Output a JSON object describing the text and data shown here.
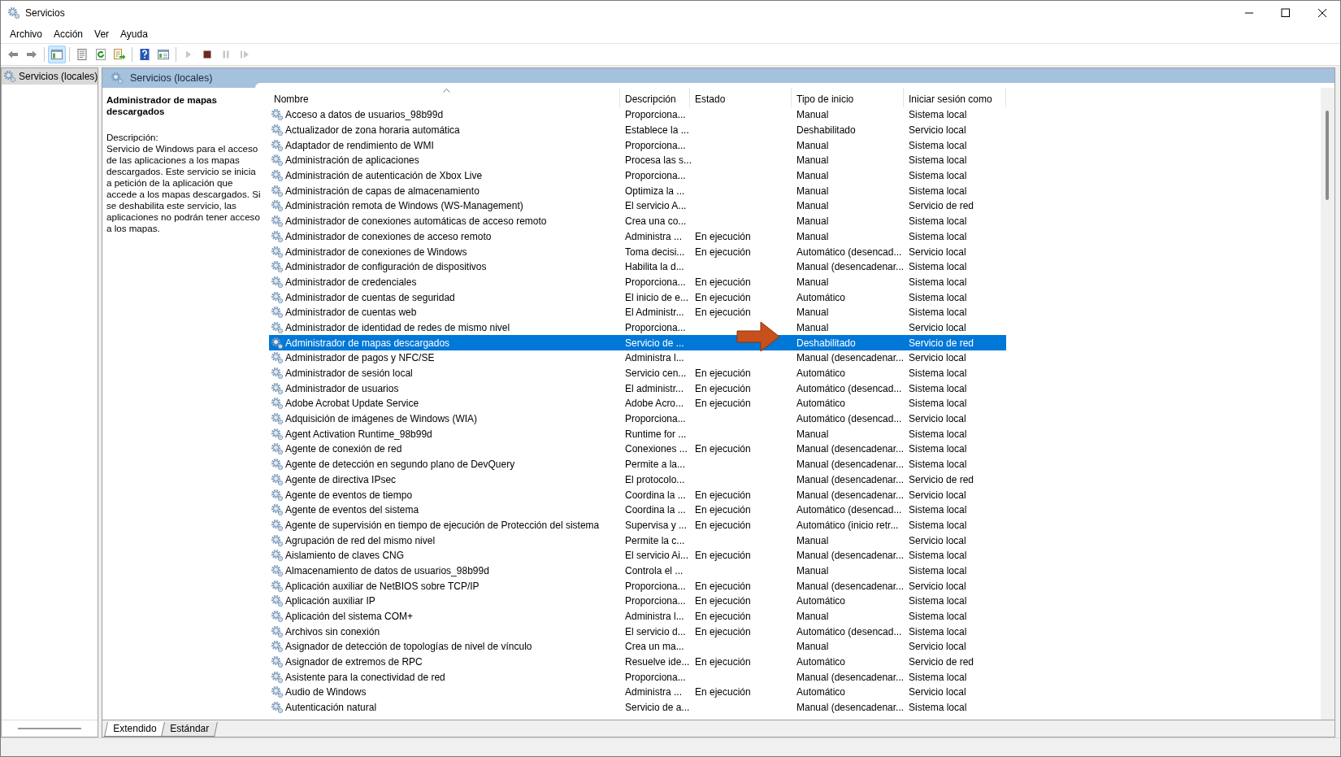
{
  "window": {
    "title": "Servicios"
  },
  "menu": [
    "Archivo",
    "Acción",
    "Ver",
    "Ayuda"
  ],
  "toolbar": [
    {
      "kind": "back",
      "disabled": false,
      "pressed": false
    },
    {
      "kind": "forward",
      "disabled": false,
      "pressed": false
    },
    {
      "kind": "sep"
    },
    {
      "kind": "tree",
      "disabled": false,
      "pressed": true
    },
    {
      "kind": "sep"
    },
    {
      "kind": "properties",
      "disabled": false,
      "pressed": false
    },
    {
      "kind": "refresh",
      "disabled": false,
      "pressed": false
    },
    {
      "kind": "export",
      "disabled": false,
      "pressed": false
    },
    {
      "kind": "sep"
    },
    {
      "kind": "help",
      "disabled": false,
      "pressed": false
    },
    {
      "kind": "pane",
      "disabled": false,
      "pressed": false
    },
    {
      "kind": "sep"
    },
    {
      "kind": "start",
      "disabled": true,
      "pressed": false
    },
    {
      "kind": "stop",
      "disabled": false,
      "pressed": false
    },
    {
      "kind": "pause",
      "disabled": true,
      "pressed": false
    },
    {
      "kind": "restart",
      "disabled": true,
      "pressed": false
    }
  ],
  "tree": {
    "items": [
      {
        "label": "Servicios (locales)",
        "selected": true
      }
    ]
  },
  "pane_header": "Servicios (locales)",
  "details": {
    "title": "Administrador de mapas descargados",
    "description_label": "Descripción:",
    "description": "Servicio de Windows para el acceso de las aplicaciones a los mapas descargados. Este servicio se inicia a petición de la aplicación que accede a los mapas descargados. Si se deshabilita este servicio, las aplicaciones no podrán tener acceso a los mapas."
  },
  "table": {
    "columns": [
      {
        "label": "Nombre",
        "sorted": true
      },
      {
        "label": "Descripción",
        "sorted": false
      },
      {
        "label": "Estado",
        "sorted": false
      },
      {
        "label": "Tipo de inicio",
        "sorted": false
      },
      {
        "label": "Iniciar sesión como",
        "sorted": false
      }
    ],
    "rows": [
      {
        "name": "Acceso a datos de usuarios_98b99d",
        "description": "Proporciona...",
        "status": "",
        "startup": "Manual",
        "logon": "Sistema local",
        "selected": false
      },
      {
        "name": "Actualizador de zona horaria automática",
        "description": "Establece la ...",
        "status": "",
        "startup": "Deshabilitado",
        "logon": "Servicio local",
        "selected": false
      },
      {
        "name": "Adaptador de rendimiento de WMI",
        "description": "Proporciona...",
        "status": "",
        "startup": "Manual",
        "logon": "Sistema local",
        "selected": false
      },
      {
        "name": "Administración de aplicaciones",
        "description": "Procesa las s...",
        "status": "",
        "startup": "Manual",
        "logon": "Sistema local",
        "selected": false
      },
      {
        "name": "Administración de autenticación de Xbox Live",
        "description": "Proporciona...",
        "status": "",
        "startup": "Manual",
        "logon": "Sistema local",
        "selected": false
      },
      {
        "name": "Administración de capas de almacenamiento",
        "description": "Optimiza la ...",
        "status": "",
        "startup": "Manual",
        "logon": "Sistema local",
        "selected": false
      },
      {
        "name": "Administración remota de Windows (WS-Management)",
        "description": "El servicio A...",
        "status": "",
        "startup": "Manual",
        "logon": "Servicio de red",
        "selected": false
      },
      {
        "name": "Administrador de conexiones automáticas de acceso remoto",
        "description": "Crea una co...",
        "status": "",
        "startup": "Manual",
        "logon": "Sistema local",
        "selected": false
      },
      {
        "name": "Administrador de conexiones de acceso remoto",
        "description": "Administra ...",
        "status": "En ejecución",
        "startup": "Manual",
        "logon": "Sistema local",
        "selected": false
      },
      {
        "name": "Administrador de conexiones de Windows",
        "description": "Toma decisi...",
        "status": "En ejecución",
        "startup": "Automático (desencad...",
        "logon": "Servicio local",
        "selected": false
      },
      {
        "name": "Administrador de configuración de dispositivos",
        "description": "Habilita la d...",
        "status": "",
        "startup": "Manual (desencadenar...",
        "logon": "Sistema local",
        "selected": false
      },
      {
        "name": "Administrador de credenciales",
        "description": "Proporciona...",
        "status": "En ejecución",
        "startup": "Manual",
        "logon": "Sistema local",
        "selected": false
      },
      {
        "name": "Administrador de cuentas de seguridad",
        "description": "El inicio de e...",
        "status": "En ejecución",
        "startup": "Automático",
        "logon": "Sistema local",
        "selected": false
      },
      {
        "name": "Administrador de cuentas web",
        "description": "El Administr...",
        "status": "En ejecución",
        "startup": "Manual",
        "logon": "Sistema local",
        "selected": false
      },
      {
        "name": "Administrador de identidad de redes de mismo nivel",
        "description": "Proporciona...",
        "status": "",
        "startup": "Manual",
        "logon": "Servicio local",
        "selected": false
      },
      {
        "name": "Administrador de mapas descargados",
        "description": "Servicio de ...",
        "status": "",
        "startup": "Deshabilitado",
        "logon": "Servicio de red",
        "selected": true
      },
      {
        "name": "Administrador de pagos y NFC/SE",
        "description": "Administra l...",
        "status": "",
        "startup": "Manual (desencadenar...",
        "logon": "Servicio local",
        "selected": false
      },
      {
        "name": "Administrador de sesión local",
        "description": "Servicio cen...",
        "status": "En ejecución",
        "startup": "Automático",
        "logon": "Sistema local",
        "selected": false
      },
      {
        "name": "Administrador de usuarios",
        "description": "El administr...",
        "status": "En ejecución",
        "startup": "Automático (desencad...",
        "logon": "Sistema local",
        "selected": false
      },
      {
        "name": "Adobe Acrobat Update Service",
        "description": "Adobe Acro...",
        "status": "En ejecución",
        "startup": "Automático",
        "logon": "Sistema local",
        "selected": false
      },
      {
        "name": "Adquisición de imágenes de Windows (WIA)",
        "description": "Proporciona...",
        "status": "",
        "startup": "Automático (desencad...",
        "logon": "Servicio local",
        "selected": false
      },
      {
        "name": "Agent Activation Runtime_98b99d",
        "description": "Runtime for ...",
        "status": "",
        "startup": "Manual",
        "logon": "Sistema local",
        "selected": false
      },
      {
        "name": "Agente de conexión de red",
        "description": "Conexiones ...",
        "status": "En ejecución",
        "startup": "Manual (desencadenar...",
        "logon": "Sistema local",
        "selected": false
      },
      {
        "name": "Agente de detección en segundo plano de DevQuery",
        "description": "Permite a la...",
        "status": "",
        "startup": "Manual (desencadenar...",
        "logon": "Sistema local",
        "selected": false
      },
      {
        "name": "Agente de directiva IPsec",
        "description": "El protocolo...",
        "status": "",
        "startup": "Manual (desencadenar...",
        "logon": "Servicio de red",
        "selected": false
      },
      {
        "name": "Agente de eventos de tiempo",
        "description": "Coordina la ...",
        "status": "En ejecución",
        "startup": "Manual (desencadenar...",
        "logon": "Servicio local",
        "selected": false
      },
      {
        "name": "Agente de eventos del sistema",
        "description": "Coordina la ...",
        "status": "En ejecución",
        "startup": "Automático (desencad...",
        "logon": "Sistema local",
        "selected": false
      },
      {
        "name": "Agente de supervisión en tiempo de ejecución de Protección del sistema",
        "description": "Supervisa y ...",
        "status": "En ejecución",
        "startup": "Automático (inicio retr...",
        "logon": "Sistema local",
        "selected": false
      },
      {
        "name": "Agrupación de red del mismo nivel",
        "description": "Permite la c...",
        "status": "",
        "startup": "Manual",
        "logon": "Servicio local",
        "selected": false
      },
      {
        "name": "Aislamiento de claves CNG",
        "description": "El servicio Ai...",
        "status": "En ejecución",
        "startup": "Manual (desencadenar...",
        "logon": "Sistema local",
        "selected": false
      },
      {
        "name": "Almacenamiento de datos de usuarios_98b99d",
        "description": "Controla el ...",
        "status": "",
        "startup": "Manual",
        "logon": "Sistema local",
        "selected": false
      },
      {
        "name": "Aplicación auxiliar de NetBIOS sobre TCP/IP",
        "description": "Proporciona...",
        "status": "En ejecución",
        "startup": "Manual (desencadenar...",
        "logon": "Servicio local",
        "selected": false
      },
      {
        "name": "Aplicación auxiliar IP",
        "description": "Proporciona...",
        "status": "En ejecución",
        "startup": "Automático",
        "logon": "Sistema local",
        "selected": false
      },
      {
        "name": "Aplicación del sistema COM+",
        "description": "Administra l...",
        "status": "En ejecución",
        "startup": "Manual",
        "logon": "Sistema local",
        "selected": false
      },
      {
        "name": "Archivos sin conexión",
        "description": "El servicio d...",
        "status": "En ejecución",
        "startup": "Automático (desencad...",
        "logon": "Sistema local",
        "selected": false
      },
      {
        "name": "Asignador de detección de topologías de nivel de vínculo",
        "description": "Crea un ma...",
        "status": "",
        "startup": "Manual",
        "logon": "Servicio local",
        "selected": false
      },
      {
        "name": "Asignador de extremos de RPC",
        "description": "Resuelve ide...",
        "status": "En ejecución",
        "startup": "Automático",
        "logon": "Servicio de red",
        "selected": false
      },
      {
        "name": "Asistente para la conectividad de red",
        "description": "Proporciona...",
        "status": "",
        "startup": "Manual (desencadenar...",
        "logon": "Sistema local",
        "selected": false
      },
      {
        "name": "Audio de Windows",
        "description": "Administra ...",
        "status": "En ejecución",
        "startup": "Automático",
        "logon": "Servicio local",
        "selected": false
      },
      {
        "name": "Autenticación natural",
        "description": "Servicio de a...",
        "status": "",
        "startup": "Manual (desencadenar...",
        "logon": "Sistema local",
        "selected": false
      }
    ]
  },
  "view_tabs": [
    {
      "label": "Extendido",
      "selected": true
    },
    {
      "label": "Estándar",
      "selected": false
    }
  ]
}
